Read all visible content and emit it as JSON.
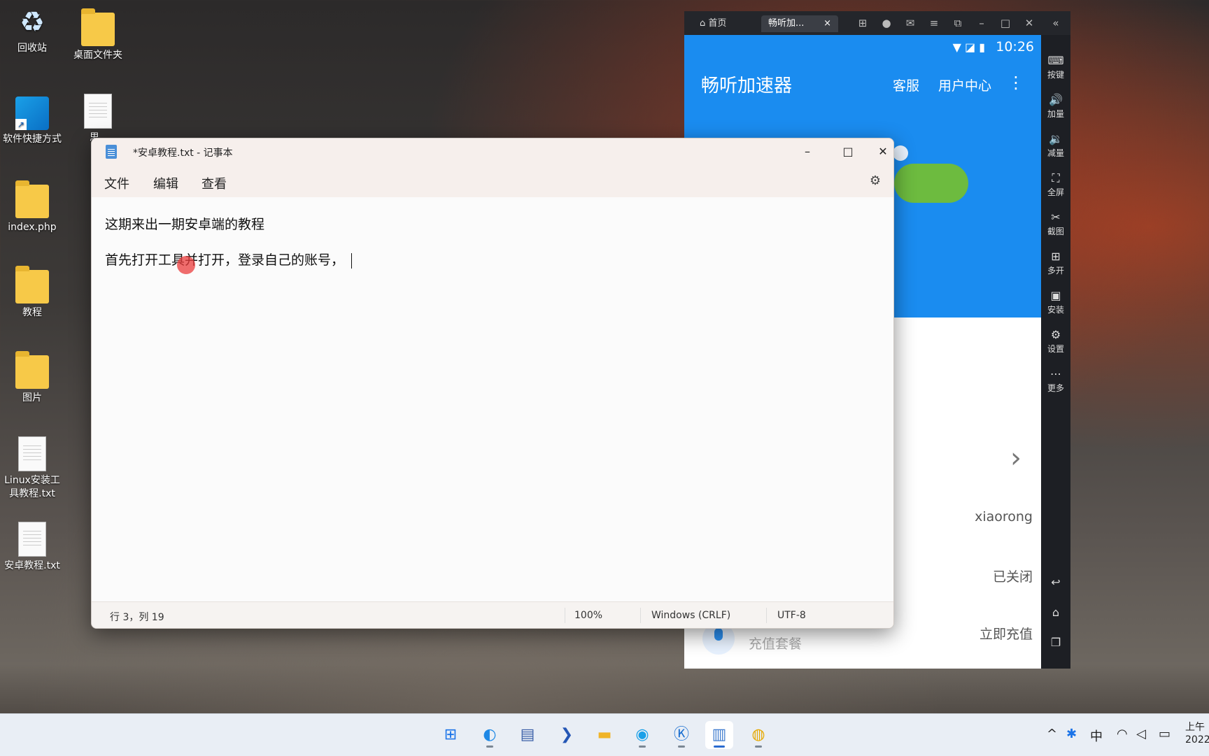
{
  "desktop": {
    "icons": [
      {
        "label": "回收站"
      },
      {
        "label": "桌面文件夹"
      },
      {
        "label": "软件快捷方式"
      },
      {
        "label": "思"
      },
      {
        "label": "index.php"
      },
      {
        "label": "教程"
      },
      {
        "label": "图片"
      },
      {
        "label": "Linux安装工具教程.txt"
      },
      {
        "label": "安卓教程.txt"
      }
    ]
  },
  "emulator": {
    "tabs": [
      {
        "label": "首页"
      },
      {
        "label": "畅听加..."
      }
    ],
    "status_time": "10:26",
    "app": {
      "title": "畅听加速器",
      "nav": [
        "客服",
        "用户中心"
      ],
      "rows": {
        "username": "xiaorong",
        "state": "已关闭",
        "recharge_action": "立即充值",
        "recharge_label": "充值套餐"
      }
    },
    "sidebar": [
      "按键",
      "加量",
      "减量",
      "全屏",
      "截图",
      "多开",
      "安装",
      "设置",
      "更多"
    ]
  },
  "notepad": {
    "title": "*安卓教程.txt - 记事本",
    "menu": [
      "文件",
      "编辑",
      "查看"
    ],
    "lines": [
      "这期来出一期安卓端的教程",
      "首先打开工具并打开，登录自己的账号，"
    ],
    "status": {
      "position": "行 3，列 19",
      "zoom": "100%",
      "line_ending": "Windows (CRLF)",
      "encoding": "UTF-8"
    }
  },
  "taskbar": {
    "ime": "中",
    "clock": "上午 2022"
  }
}
